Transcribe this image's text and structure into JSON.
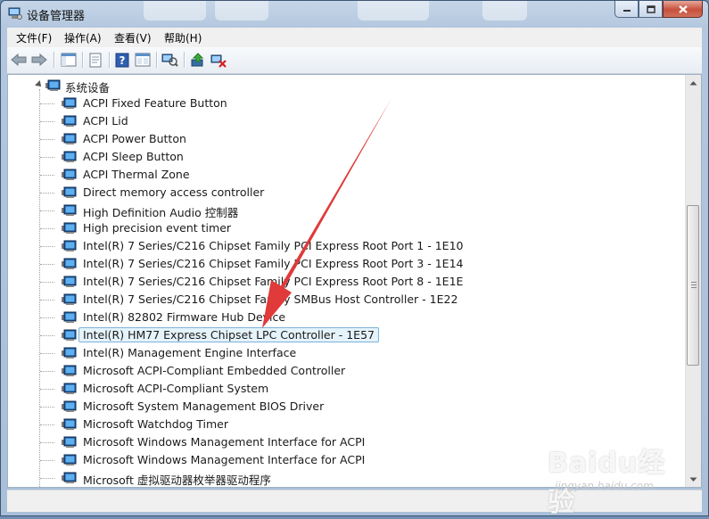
{
  "window": {
    "title": "设备管理器"
  },
  "menu": [
    "文件(F)",
    "操作(A)",
    "查看(V)",
    "帮助(H)"
  ],
  "toolbar": {
    "icons": [
      "back-arrow",
      "forward-arrow",
      "tree-view",
      "properties",
      "help",
      "view-toggle",
      "scan-hardware",
      "update-driver",
      "uninstall-device"
    ]
  },
  "tree": {
    "root_label": "系统设备",
    "devices": [
      "ACPI Fixed Feature Button",
      "ACPI Lid",
      "ACPI Power Button",
      "ACPI Sleep Button",
      "ACPI Thermal Zone",
      "Direct memory access controller",
      "High Definition Audio 控制器",
      "High precision event timer",
      "Intel(R) 7 Series/C216 Chipset Family PCI Express Root Port 1 - 1E10",
      "Intel(R) 7 Series/C216 Chipset Family PCI Express Root Port 3 - 1E14",
      "Intel(R) 7 Series/C216 Chipset Family PCI Express Root Port 8 - 1E1E",
      "Intel(R) 7 Series/C216 Chipset Family SMBus Host Controller - 1E22",
      "Intel(R) 82802 Firmware Hub Device",
      "Intel(R) HM77 Express Chipset LPC Controller - 1E57",
      "Intel(R) Management Engine Interface",
      "Microsoft ACPI-Compliant Embedded Controller",
      "Microsoft ACPI-Compliant System",
      "Microsoft System Management BIOS Driver",
      "Microsoft Watchdog Timer",
      "Microsoft Windows Management Interface for ACPI",
      "Microsoft Windows Management Interface for ACPI",
      "Microsoft 虚拟驱动器枚举器驱动程序"
    ],
    "selected_index": 13
  },
  "watermark": {
    "main": "Baidu经验",
    "sub": "jingyan.baidu.com"
  },
  "colors": {
    "annotation_arrow": "#e03a3a",
    "selection_bg": "#e5f3fb",
    "selection_border": "#7cb3d8"
  }
}
